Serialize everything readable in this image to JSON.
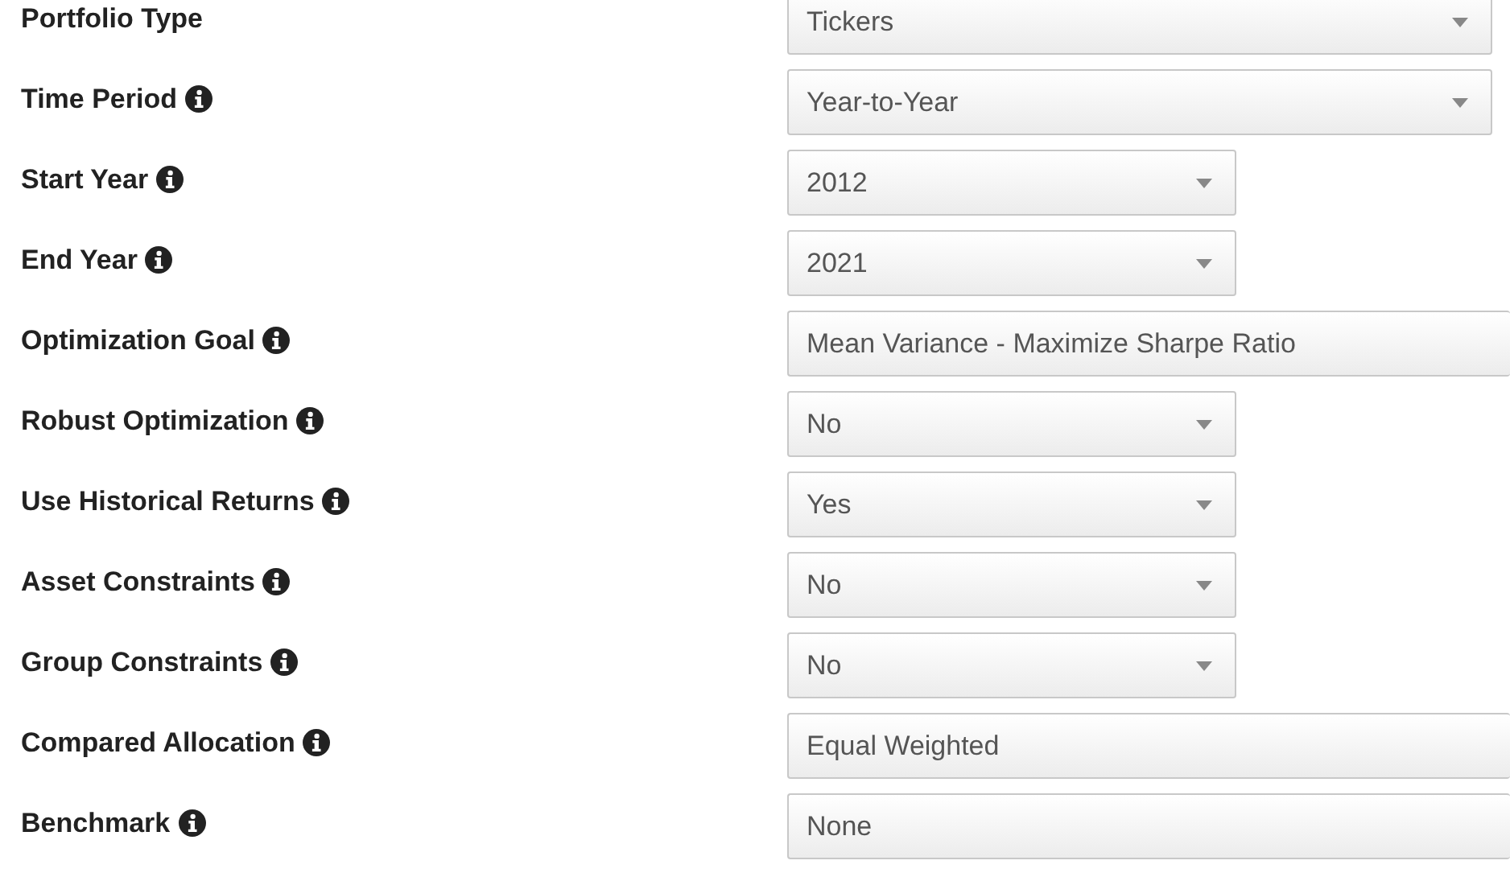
{
  "fields": [
    {
      "label": "Portfolio Type",
      "info": false,
      "kind": "full",
      "value": "Tickers"
    },
    {
      "label": "Time Period",
      "info": true,
      "kind": "full",
      "value": "Year-to-Year"
    },
    {
      "label": "Start Year",
      "info": true,
      "kind": "short",
      "value": "2012"
    },
    {
      "label": "End Year",
      "info": true,
      "kind": "short",
      "value": "2021"
    },
    {
      "label": "Optimization Goal",
      "info": true,
      "kind": "wide",
      "value": "Mean Variance - Maximize Sharpe Ratio"
    },
    {
      "label": "Robust Optimization",
      "info": true,
      "kind": "short",
      "value": "No"
    },
    {
      "label": "Use Historical Returns",
      "info": true,
      "kind": "short",
      "value": "Yes"
    },
    {
      "label": "Asset Constraints",
      "info": true,
      "kind": "short",
      "value": "No"
    },
    {
      "label": "Group Constraints",
      "info": true,
      "kind": "short",
      "value": "No"
    },
    {
      "label": "Compared Allocation",
      "info": true,
      "kind": "wide",
      "value": "Equal Weighted"
    },
    {
      "label": "Benchmark",
      "info": true,
      "kind": "wide",
      "value": "None"
    }
  ]
}
